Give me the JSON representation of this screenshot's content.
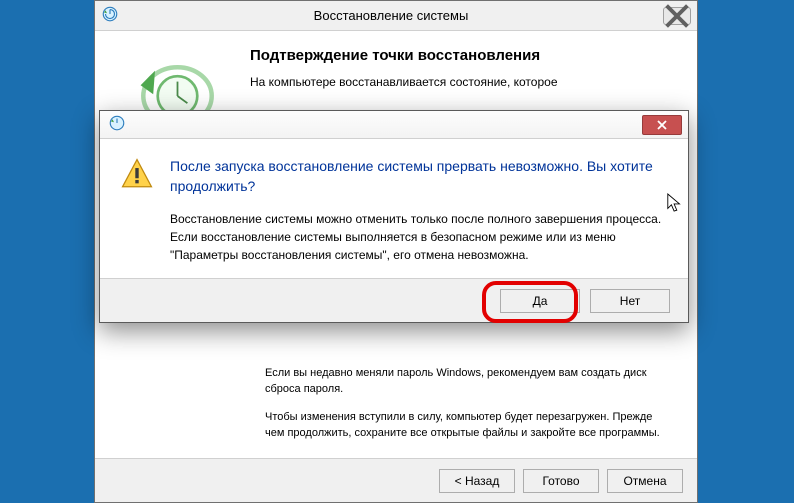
{
  "parent": {
    "title": "Восстановление системы",
    "heading": "Подтверждение точки восстановления",
    "intro": "На компьютере восстанавливается состояние, которое",
    "lower1": "Если вы недавно меняли пароль Windows, рекомендуем вам создать диск сброса пароля.",
    "lower2": "Чтобы изменения вступили в силу, компьютер будет перезагружен. Прежде чем продолжить, сохраните все открытые файлы и закройте все программы.",
    "back": "< Назад",
    "finish": "Готово",
    "cancel": "Отмена"
  },
  "dialog": {
    "heading": "После запуска восстановление системы прервать невозможно. Вы хотите продолжить?",
    "body": "Восстановление системы можно отменить только после полного завершения процесса. Если восстановление системы выполняется в безопасном режиме или из меню \"Параметры восстановления системы\", его отмена невозможна.",
    "yes": "Да",
    "no": "Нет"
  }
}
